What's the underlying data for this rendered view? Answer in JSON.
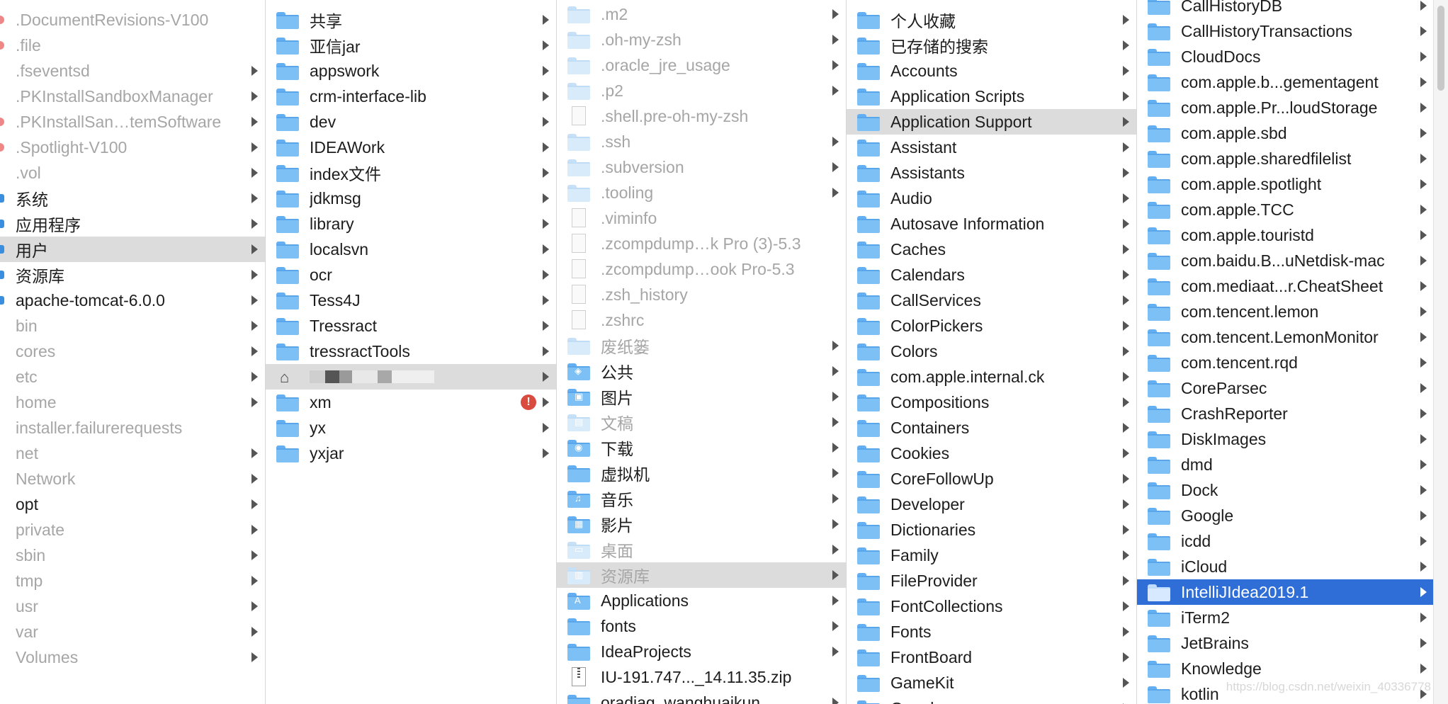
{
  "watermark": "https://blog.csdn.net/weixin_40336778",
  "columns": [
    {
      "id": "root",
      "rows": [
        {
          "label": ".DocumentRevisions-V100",
          "dim": true,
          "mark": "red",
          "arrow": false
        },
        {
          "label": ".file",
          "dim": true,
          "mark": "red",
          "arrow": false
        },
        {
          "label": ".fseventsd",
          "dim": true,
          "mark": "none",
          "arrow": true
        },
        {
          "label": ".PKInstallSandboxManager",
          "dim": true,
          "mark": "none",
          "arrow": true
        },
        {
          "label": ".PKInstallSan…temSoftware",
          "dim": true,
          "mark": "red",
          "arrow": true
        },
        {
          "label": ".Spotlight-V100",
          "dim": true,
          "mark": "red",
          "arrow": true
        },
        {
          "label": ".vol",
          "dim": true,
          "mark": "none",
          "arrow": true
        },
        {
          "label": "系统",
          "dim": false,
          "mark": "blue",
          "arrow": true
        },
        {
          "label": "应用程序",
          "dim": false,
          "mark": "blue",
          "arrow": true
        },
        {
          "label": "用户",
          "dim": false,
          "mark": "blue",
          "arrow": true,
          "selected": "gray"
        },
        {
          "label": "资源库",
          "dim": false,
          "mark": "blue",
          "arrow": true
        },
        {
          "label": "apache-tomcat-6.0.0",
          "dim": false,
          "mark": "blue",
          "arrow": true
        },
        {
          "label": "bin",
          "dim": true,
          "mark": "none",
          "arrow": true
        },
        {
          "label": "cores",
          "dim": true,
          "mark": "none",
          "arrow": true
        },
        {
          "label": "etc",
          "dim": true,
          "mark": "none",
          "arrow": true
        },
        {
          "label": "home",
          "dim": true,
          "mark": "none",
          "arrow": true
        },
        {
          "label": "installer.failurerequests",
          "dim": true,
          "mark": "none",
          "arrow": false
        },
        {
          "label": "net",
          "dim": true,
          "mark": "none",
          "arrow": true
        },
        {
          "label": "Network",
          "dim": true,
          "mark": "none",
          "arrow": true
        },
        {
          "label": "opt",
          "dim": false,
          "mark": "none",
          "arrow": true
        },
        {
          "label": "private",
          "dim": true,
          "mark": "none",
          "arrow": true
        },
        {
          "label": "sbin",
          "dim": true,
          "mark": "none",
          "arrow": true
        },
        {
          "label": "tmp",
          "dim": true,
          "mark": "none",
          "arrow": true
        },
        {
          "label": "usr",
          "dim": true,
          "mark": "none",
          "arrow": true
        },
        {
          "label": "var",
          "dim": true,
          "mark": "none",
          "arrow": true
        },
        {
          "label": "Volumes",
          "dim": true,
          "mark": "none",
          "arrow": true
        }
      ]
    },
    {
      "id": "users",
      "rows": [
        {
          "label": "共享",
          "icon": "folder-icon",
          "arrow": true
        },
        {
          "label": "亚信jar",
          "icon": "folder-icon",
          "arrow": true
        },
        {
          "label": "appswork",
          "icon": "folder-icon",
          "arrow": true
        },
        {
          "label": "crm-interface-lib",
          "icon": "folder-icon",
          "arrow": true
        },
        {
          "label": "dev",
          "icon": "folder-icon",
          "arrow": true
        },
        {
          "label": "IDEAWork",
          "icon": "folder-icon",
          "arrow": true
        },
        {
          "label": "index文件",
          "icon": "folder-icon",
          "arrow": true
        },
        {
          "label": "jdkmsg",
          "icon": "folder-icon",
          "arrow": true
        },
        {
          "label": "library",
          "icon": "folder-icon",
          "arrow": true
        },
        {
          "label": "localsvn",
          "icon": "folder-icon",
          "arrow": true
        },
        {
          "label": "ocr",
          "icon": "folder-icon",
          "arrow": true
        },
        {
          "label": "Tess4J",
          "icon": "folder-icon",
          "arrow": true
        },
        {
          "label": "Tressract",
          "icon": "folder-icon",
          "arrow": true
        },
        {
          "label": "tressractTools",
          "icon": "folder-icon",
          "arrow": true
        },
        {
          "label": "",
          "icon": "home-icon",
          "arrow": true,
          "selected": "gray",
          "redacted": true
        },
        {
          "label": "xm",
          "icon": "folder-icon",
          "arrow": true,
          "badge": "!"
        },
        {
          "label": "yx",
          "icon": "folder-icon",
          "arrow": true
        },
        {
          "label": "yxjar",
          "icon": "folder-icon",
          "arrow": true
        }
      ]
    },
    {
      "id": "home",
      "rows": [
        {
          "label": ".m2",
          "icon": "folder-icon",
          "dim": true,
          "arrow": true
        },
        {
          "label": ".oh-my-zsh",
          "icon": "folder-icon",
          "dim": true,
          "arrow": true
        },
        {
          "label": ".oracle_jre_usage",
          "icon": "folder-icon",
          "dim": true,
          "arrow": true
        },
        {
          "label": ".p2",
          "icon": "folder-icon",
          "dim": true,
          "arrow": true
        },
        {
          "label": ".shell.pre-oh-my-zsh",
          "icon": "document-icon",
          "dim": true,
          "arrow": false
        },
        {
          "label": ".ssh",
          "icon": "folder-icon",
          "dim": true,
          "arrow": true
        },
        {
          "label": ".subversion",
          "icon": "folder-icon",
          "dim": true,
          "arrow": true
        },
        {
          "label": ".tooling",
          "icon": "folder-icon",
          "dim": true,
          "arrow": true
        },
        {
          "label": ".viminfo",
          "icon": "document-icon",
          "dim": true,
          "arrow": false
        },
        {
          "label": ".zcompdump…k Pro (3)-5.3",
          "icon": "document-icon",
          "dim": true,
          "arrow": false
        },
        {
          "label": ".zcompdump…ook Pro-5.3",
          "icon": "document-icon",
          "dim": true,
          "arrow": false
        },
        {
          "label": ".zsh_history",
          "icon": "document-icon",
          "dim": true,
          "arrow": false
        },
        {
          "label": ".zshrc",
          "icon": "document-icon",
          "dim": true,
          "arrow": false
        },
        {
          "label": "废纸篓",
          "icon": "folder-icon",
          "dim": true,
          "arrow": true
        },
        {
          "label": "公共",
          "icon": "public-folder-icon",
          "glyph": "◈",
          "arrow": true
        },
        {
          "label": "图片",
          "icon": "pictures-folder-icon",
          "glyph": "▣",
          "arrow": true
        },
        {
          "label": "文稿",
          "icon": "documents-folder-icon",
          "glyph": "▤",
          "dim": true,
          "arrow": true
        },
        {
          "label": "下载",
          "icon": "downloads-folder-icon",
          "glyph": "◉",
          "arrow": true
        },
        {
          "label": "虚拟机",
          "icon": "folder-icon",
          "arrow": true
        },
        {
          "label": "音乐",
          "icon": "music-folder-icon",
          "glyph": "♫",
          "arrow": true
        },
        {
          "label": "影片",
          "icon": "movies-folder-icon",
          "glyph": "▦",
          "arrow": true
        },
        {
          "label": "桌面",
          "icon": "desktop-folder-icon",
          "glyph": "▭",
          "dim": true,
          "arrow": true
        },
        {
          "label": "资源库",
          "icon": "library-folder-icon",
          "glyph": "▥",
          "dim": true,
          "arrow": true,
          "selected": "gray"
        },
        {
          "label": "Applications",
          "icon": "applications-folder-icon",
          "glyph": "A",
          "arrow": true
        },
        {
          "label": "fonts",
          "icon": "folder-icon",
          "arrow": true
        },
        {
          "label": "IdeaProjects",
          "icon": "folder-icon",
          "arrow": true
        },
        {
          "label": "IU-191.747..._14.11.35.zip",
          "icon": "zip-icon",
          "arrow": false
        },
        {
          "label": "oradiag_wanghuaikun",
          "icon": "folder-icon",
          "arrow": true
        }
      ]
    },
    {
      "id": "library",
      "rows": [
        {
          "label": "个人收藏",
          "arrow": true
        },
        {
          "label": "已存储的搜索",
          "arrow": true
        },
        {
          "label": "Accounts",
          "arrow": true
        },
        {
          "label": "Application Scripts",
          "arrow": true
        },
        {
          "label": "Application Support",
          "arrow": true,
          "selected": "gray"
        },
        {
          "label": "Assistant",
          "arrow": true
        },
        {
          "label": "Assistants",
          "arrow": true
        },
        {
          "label": "Audio",
          "arrow": true
        },
        {
          "label": "Autosave Information",
          "arrow": true
        },
        {
          "label": "Caches",
          "arrow": true
        },
        {
          "label": "Calendars",
          "arrow": true
        },
        {
          "label": "CallServices",
          "arrow": true
        },
        {
          "label": "ColorPickers",
          "arrow": true
        },
        {
          "label": "Colors",
          "arrow": true
        },
        {
          "label": "com.apple.internal.ck",
          "arrow": true
        },
        {
          "label": "Compositions",
          "arrow": true
        },
        {
          "label": "Containers",
          "arrow": true
        },
        {
          "label": "Cookies",
          "arrow": true
        },
        {
          "label": "CoreFollowUp",
          "arrow": true
        },
        {
          "label": "Developer",
          "arrow": true
        },
        {
          "label": "Dictionaries",
          "arrow": true
        },
        {
          "label": "Family",
          "arrow": true
        },
        {
          "label": "FileProvider",
          "arrow": true
        },
        {
          "label": "FontCollections",
          "arrow": true
        },
        {
          "label": "Fonts",
          "arrow": true
        },
        {
          "label": "FrontBoard",
          "arrow": true
        },
        {
          "label": "GameKit",
          "arrow": true
        },
        {
          "label": "Google",
          "arrow": true
        }
      ]
    },
    {
      "id": "app-support",
      "rows": [
        {
          "label": "CallHistoryDB",
          "arrow": true
        },
        {
          "label": "CallHistoryTransactions",
          "arrow": true
        },
        {
          "label": "CloudDocs",
          "arrow": true
        },
        {
          "label": "com.apple.b...gementagent",
          "arrow": true
        },
        {
          "label": "com.apple.Pr...loudStorage",
          "arrow": true
        },
        {
          "label": "com.apple.sbd",
          "arrow": true
        },
        {
          "label": "com.apple.sharedfilelist",
          "arrow": true
        },
        {
          "label": "com.apple.spotlight",
          "arrow": true
        },
        {
          "label": "com.apple.TCC",
          "arrow": true
        },
        {
          "label": "com.apple.touristd",
          "arrow": true
        },
        {
          "label": "com.baidu.B...uNetdisk-mac",
          "arrow": true
        },
        {
          "label": "com.mediaat...r.CheatSheet",
          "arrow": true
        },
        {
          "label": "com.tencent.lemon",
          "arrow": true
        },
        {
          "label": "com.tencent.LemonMonitor",
          "arrow": true
        },
        {
          "label": "com.tencent.rqd",
          "arrow": true
        },
        {
          "label": "CoreParsec",
          "arrow": true
        },
        {
          "label": "CrashReporter",
          "arrow": true
        },
        {
          "label": "DiskImages",
          "arrow": true
        },
        {
          "label": "dmd",
          "arrow": true
        },
        {
          "label": "Dock",
          "arrow": true
        },
        {
          "label": "Google",
          "arrow": true
        },
        {
          "label": "icdd",
          "arrow": true
        },
        {
          "label": "iCloud",
          "arrow": true
        },
        {
          "label": "IntelliJIdea2019.1",
          "arrow": true,
          "selected": "blue"
        },
        {
          "label": "iTerm2",
          "arrow": true
        },
        {
          "label": "JetBrains",
          "arrow": true
        },
        {
          "label": "Knowledge",
          "arrow": true
        },
        {
          "label": "kotlin",
          "arrow": true
        }
      ]
    }
  ]
}
